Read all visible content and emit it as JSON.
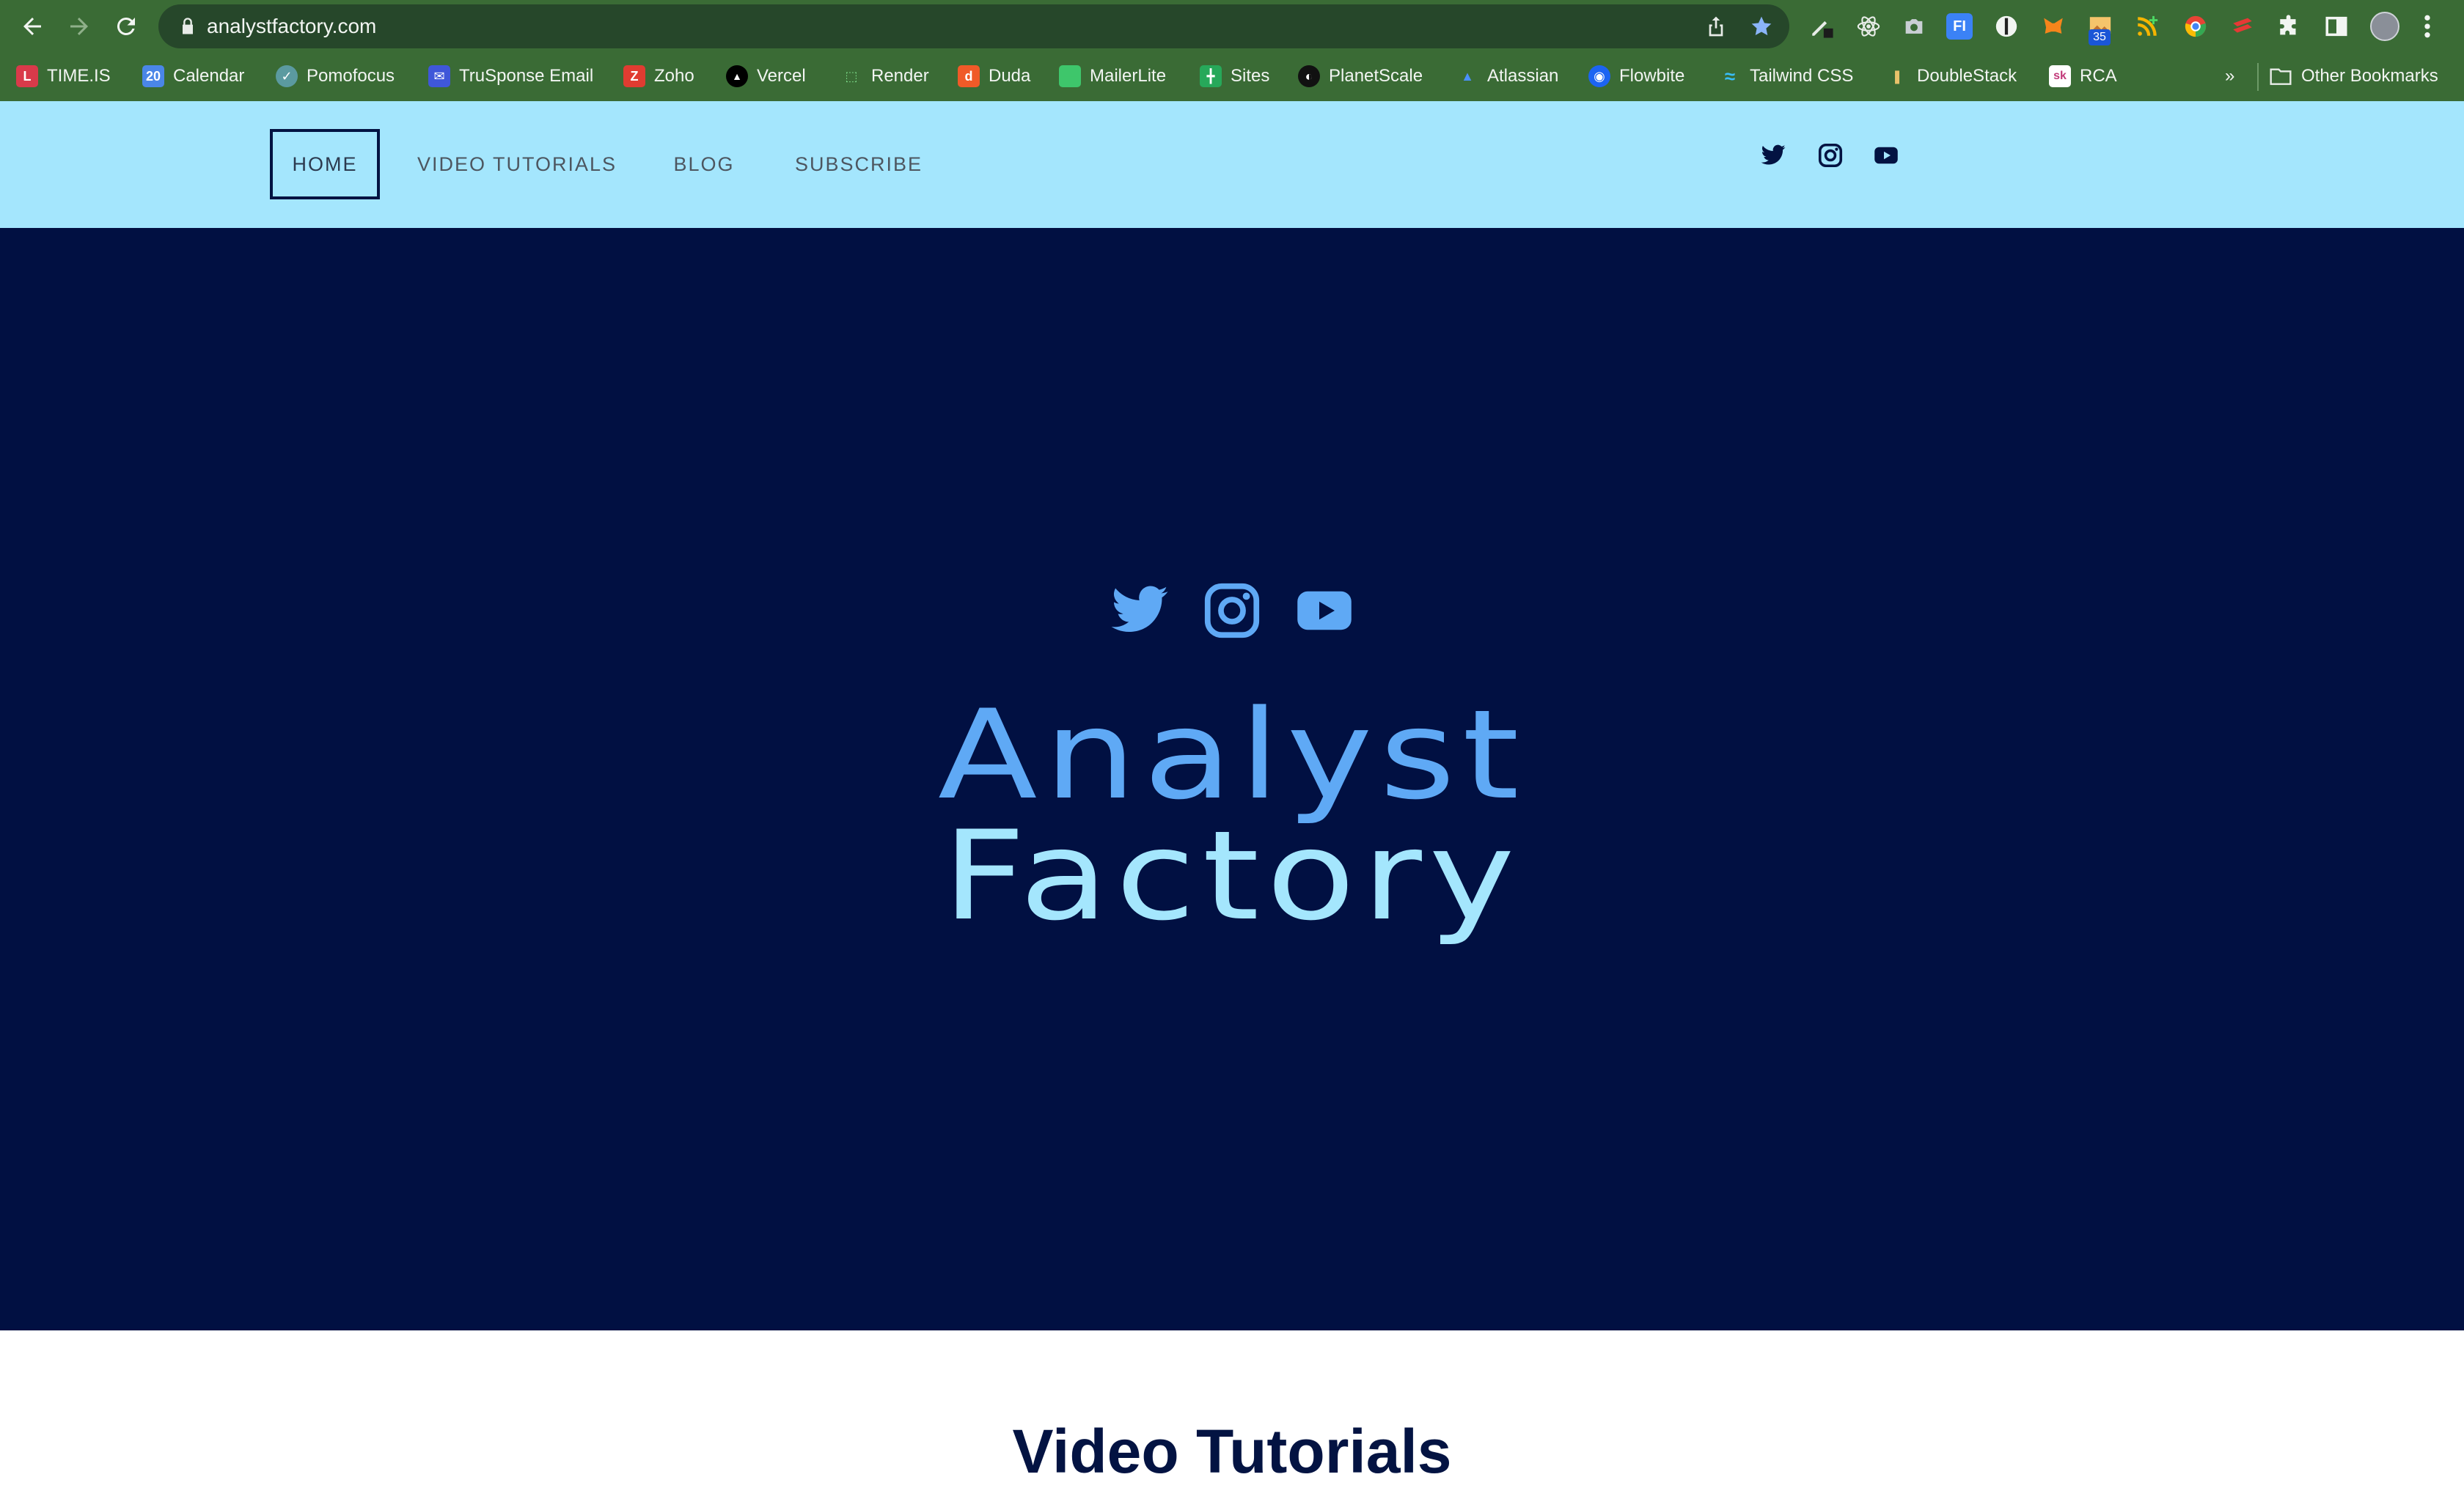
{
  "browser": {
    "url": "analystfactory.com",
    "extension_badge": "35",
    "bookmarks": [
      {
        "label": "TIME.IS",
        "icon": "timeis-icon",
        "glyph": "L",
        "color": "#d93a4a"
      },
      {
        "label": "Calendar",
        "icon": "calendar-icon",
        "glyph": "20",
        "color": "#4a86e8"
      },
      {
        "label": "Pomofocus",
        "icon": "pomofocus-icon",
        "glyph": "✓",
        "color": "#5b9aa0"
      },
      {
        "label": "TruSponse Email",
        "icon": "mail-icon",
        "glyph": "✉",
        "color": "#3f57d9"
      },
      {
        "label": "Zoho",
        "icon": "zoho-icon",
        "glyph": "Z",
        "color": "#e03c31"
      },
      {
        "label": "Vercel",
        "icon": "vercel-icon",
        "glyph": "▲",
        "color": "#000000"
      },
      {
        "label": "Render",
        "icon": "render-icon",
        "glyph": "⬚",
        "color": "#3a6b35"
      },
      {
        "label": "Duda",
        "icon": "duda-icon",
        "glyph": "d",
        "color": "#f05a28"
      },
      {
        "label": "MailerLite",
        "icon": "mailerlite-icon",
        "glyph": "▬",
        "color": "#3ec66b"
      },
      {
        "label": "Sites",
        "icon": "sites-icon",
        "glyph": "╋",
        "color": "#27a85a"
      },
      {
        "label": "PlanetScale",
        "icon": "planetscale-icon",
        "glyph": "◐",
        "color": "#111111"
      },
      {
        "label": "Atlassian",
        "icon": "atlassian-icon",
        "glyph": "▲",
        "color": "#2684ff"
      },
      {
        "label": "Flowbite",
        "icon": "flowbite-icon",
        "glyph": "◉",
        "color": "#1c64f2"
      },
      {
        "label": "Tailwind CSS",
        "icon": "tailwind-icon",
        "glyph": "≈",
        "color": "#38bdf8"
      },
      {
        "label": "DoubleStack",
        "icon": "doublestack-icon",
        "glyph": "❚",
        "color": "#e8c26a"
      },
      {
        "label": "RCA",
        "icon": "rca-icon",
        "glyph": "sk",
        "color": "#c23a7a"
      }
    ],
    "more_bookmarks": "»",
    "other_bookmarks": "Other Bookmarks"
  },
  "site_nav": {
    "links": [
      "HOME",
      "VIDEO TUTORIALS",
      "BLOG",
      "SUBSCRIBE"
    ],
    "active": "HOME",
    "social_icons": [
      "twitter-icon",
      "instagram-icon",
      "youtube-icon"
    ]
  },
  "hero": {
    "title_line1": "Analyst",
    "title_line2": "Factory",
    "social_icons": [
      "twitter-icon",
      "instagram-icon",
      "youtube-icon"
    ]
  },
  "section": {
    "title": "Video Tutorials"
  },
  "colors": {
    "chrome": "#3a6b35",
    "nav_bg": "#a4e6fd",
    "hero_bg": "#011042",
    "accent_blue": "#5fa9f5",
    "accent_light": "#a4e6fd",
    "navy": "#031342"
  }
}
